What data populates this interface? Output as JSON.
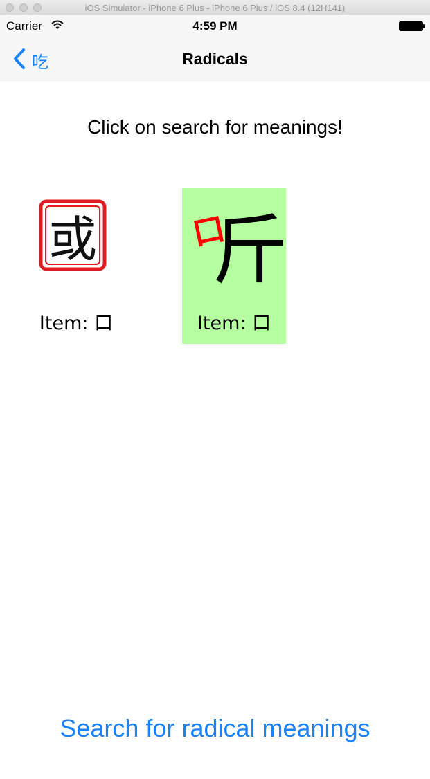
{
  "window": {
    "title": "iOS Simulator - iPhone 6 Plus - iPhone 6 Plus / iOS 8.4 (12H141)"
  },
  "status_bar": {
    "carrier": "Carrier",
    "time": "4:59 PM",
    "icons": [
      "wifi-icon",
      "battery-icon"
    ]
  },
  "nav": {
    "back_label": "吃",
    "back_icon": "chevron-left-icon",
    "title": "Radicals"
  },
  "main": {
    "instruction": "Click on search for meanings!",
    "items": [
      {
        "label": "Item: 口",
        "glyph_a": "或",
        "image": "seal-stamp",
        "selected": false
      },
      {
        "label": "Item: 口",
        "glyph_a": "口",
        "glyph_b": "斤",
        "image": "calligraphy-ting",
        "selected": true
      }
    ],
    "search_button": "Search for radical meanings"
  },
  "colors": {
    "accent": "#1a82fb",
    "selected_bg": "#b5fea0",
    "seal_red": "#e11b22",
    "radical_red": "#ff0000"
  }
}
